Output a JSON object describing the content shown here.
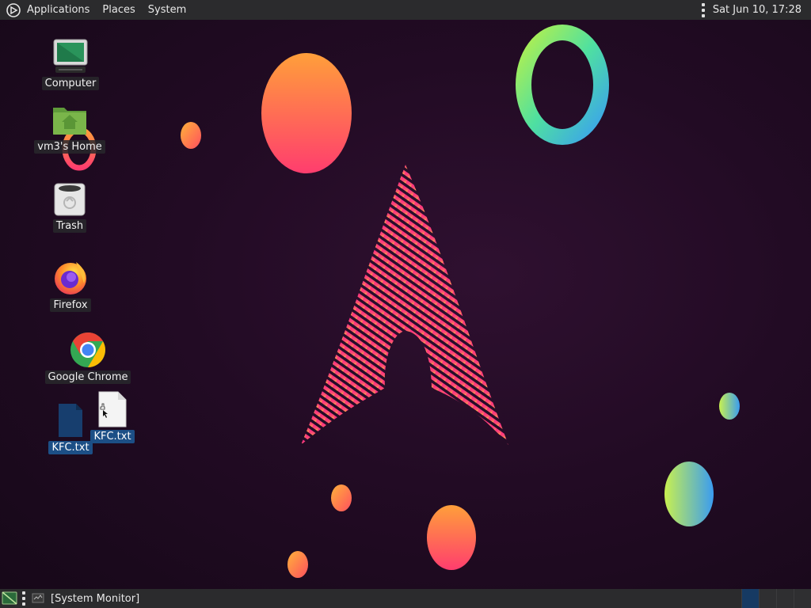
{
  "top_panel": {
    "menus": [
      {
        "label": "Applications"
      },
      {
        "label": "Places"
      },
      {
        "label": "System"
      }
    ],
    "clock": "Sat Jun 10, 17:28"
  },
  "desktop": {
    "icons": [
      {
        "label": "Computer",
        "icon": "computer-icon"
      },
      {
        "label": "vm3's Home",
        "icon": "home-folder-icon"
      },
      {
        "label": "Trash",
        "icon": "trash-icon"
      },
      {
        "label": "Firefox",
        "icon": "firefox-icon"
      },
      {
        "label": "Google Chrome",
        "icon": "chrome-icon"
      },
      {
        "label": "KFC.txt",
        "icon": "text-file-icon",
        "selected": true
      },
      {
        "label": "KFC.txt",
        "icon": "text-file-icon",
        "selected": true
      }
    ]
  },
  "bottom_panel": {
    "task": "[System Monitor]",
    "workspace_count": 4,
    "active_workspace": 1
  },
  "colors": {
    "panel": "#2b2b2d",
    "selection": "#1c4f86",
    "wallpaper": "#220b24"
  }
}
